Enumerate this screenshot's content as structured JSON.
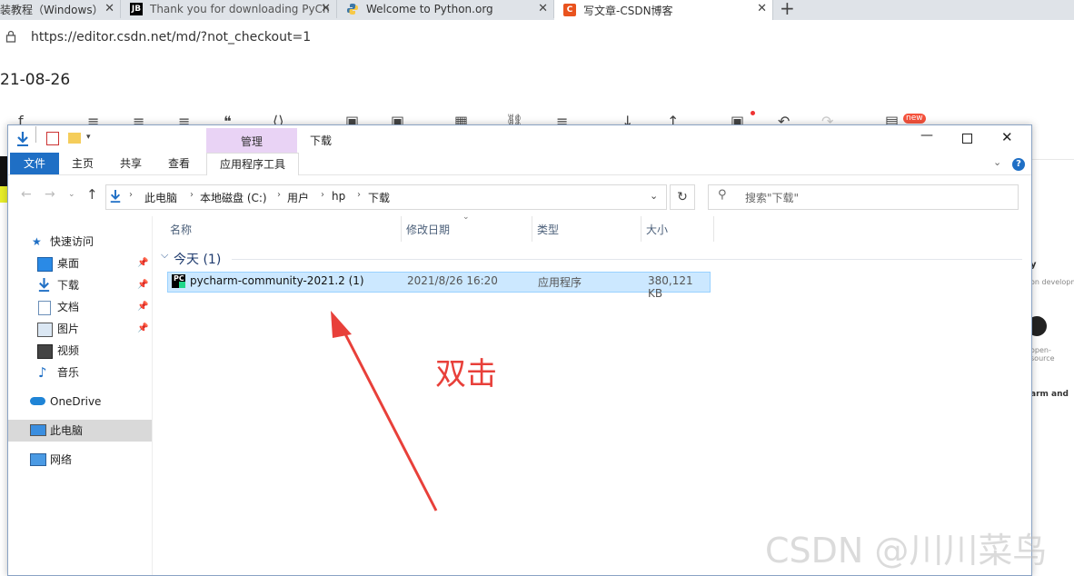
{
  "browser": {
    "tabs": [
      {
        "label": "装教程（Windows）",
        "favicon": "page-icon"
      },
      {
        "label": "Thank you for downloading PyCh",
        "favicon": "jetbrains-icon"
      },
      {
        "label": "Welcome to Python.org",
        "favicon": "python-icon"
      },
      {
        "label": "写文章-CSDN博客",
        "favicon": "csdn-icon"
      }
    ],
    "close_glyph": "✕",
    "new_tab_glyph": "+",
    "url": "https://editor.csdn.net/md/?not_checkout=1"
  },
  "editor": {
    "title_fragment": "21-08-26",
    "new_badge": "new"
  },
  "explorer": {
    "context_tab_group": "管理",
    "window_title": "下载",
    "ribbon_tabs": [
      "文件",
      "主页",
      "共享",
      "查看",
      "应用程序工具"
    ],
    "breadcrumb": [
      "此电脑",
      "本地磁盘 (C:)",
      "用户",
      "hp",
      "下载"
    ],
    "search_placeholder": "搜索\"下载\"",
    "sidebar": [
      {
        "label": "快速访问",
        "icon": "star-icon",
        "pinned": false
      },
      {
        "label": "桌面",
        "icon": "desktop-icon",
        "pinned": true
      },
      {
        "label": "下载",
        "icon": "download-icon",
        "pinned": true
      },
      {
        "label": "文档",
        "icon": "document-icon",
        "pinned": true
      },
      {
        "label": "图片",
        "icon": "picture-icon",
        "pinned": true
      },
      {
        "label": "视频",
        "icon": "video-icon",
        "pinned": false
      },
      {
        "label": "音乐",
        "icon": "music-icon",
        "pinned": false
      },
      {
        "label": "OneDrive",
        "icon": "cloud-icon",
        "pinned": false
      },
      {
        "label": "此电脑",
        "icon": "computer-icon",
        "pinned": false
      },
      {
        "label": "网络",
        "icon": "network-icon",
        "pinned": false
      }
    ],
    "columns": [
      "名称",
      "修改日期",
      "类型",
      "大小"
    ],
    "group_label": "今天 (1)",
    "files": [
      {
        "name": "pycharm-community-2021.2 (1)",
        "date": "2021/8/26 16:20",
        "type": "应用程序",
        "size": "380,121 KB"
      }
    ]
  },
  "annotation": {
    "text": "双击",
    "color": "#e8403a"
  },
  "right_panel": {
    "frag1": "y",
    "frag2": "on developme",
    "frag3": "open-source",
    "frag4": "arm and"
  },
  "watermark": "CSDN @川川菜鸟"
}
